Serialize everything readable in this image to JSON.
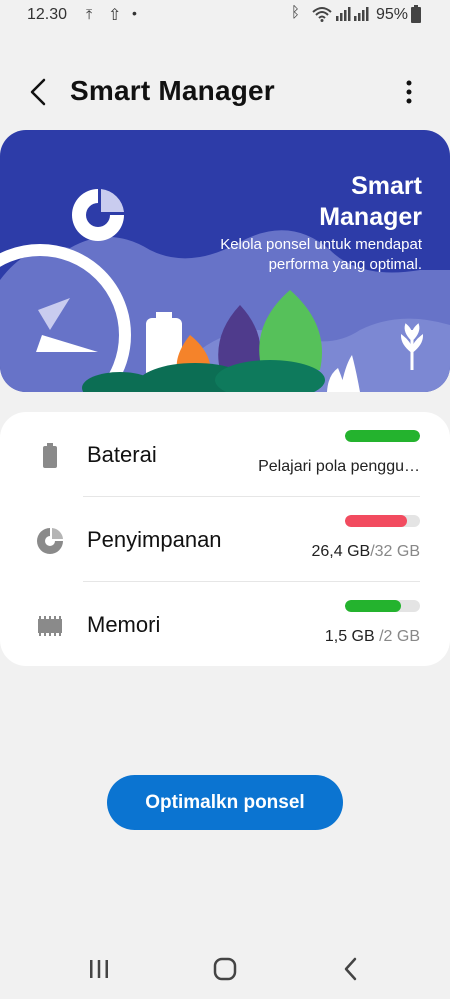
{
  "status_bar": {
    "time": "12.30",
    "battery_pct": "95%",
    "icons": [
      "upload-icon",
      "upload-icon",
      "dot-icon",
      "bluetooth-icon",
      "wifi-icon",
      "signal-icon",
      "signal-icon",
      "battery-icon"
    ]
  },
  "app_bar": {
    "title": "Smart Manager",
    "back_icon": "back-chevron-icon",
    "more_icon": "more-vertical-icon"
  },
  "hero": {
    "title": "Smart\nManager",
    "subtitle": "Kelola ponsel untuk mendapat performa yang optimal."
  },
  "items": [
    {
      "label": "Baterai",
      "detail": "Pelajari pola penggu…",
      "progress": 1.0,
      "color": "#24b32e",
      "icon": "battery-icon"
    },
    {
      "label": "Penyimpanan",
      "used": "26,4 GB",
      "total": "/32 GB",
      "progress": 0.83,
      "color": "#f24b5f",
      "icon": "storage-pie-icon"
    },
    {
      "label": "Memori",
      "used": "1,5 GB ",
      "total": "/2 GB",
      "progress": 0.75,
      "color": "#24b32e",
      "icon": "memory-chip-icon"
    }
  ],
  "optimize_button": "Optimalkn ponsel",
  "nav": [
    "recents-icon",
    "home-icon",
    "back-icon"
  ],
  "colors": {
    "hero_bg": "#2d3ca8",
    "accent": "#0b74d1"
  }
}
